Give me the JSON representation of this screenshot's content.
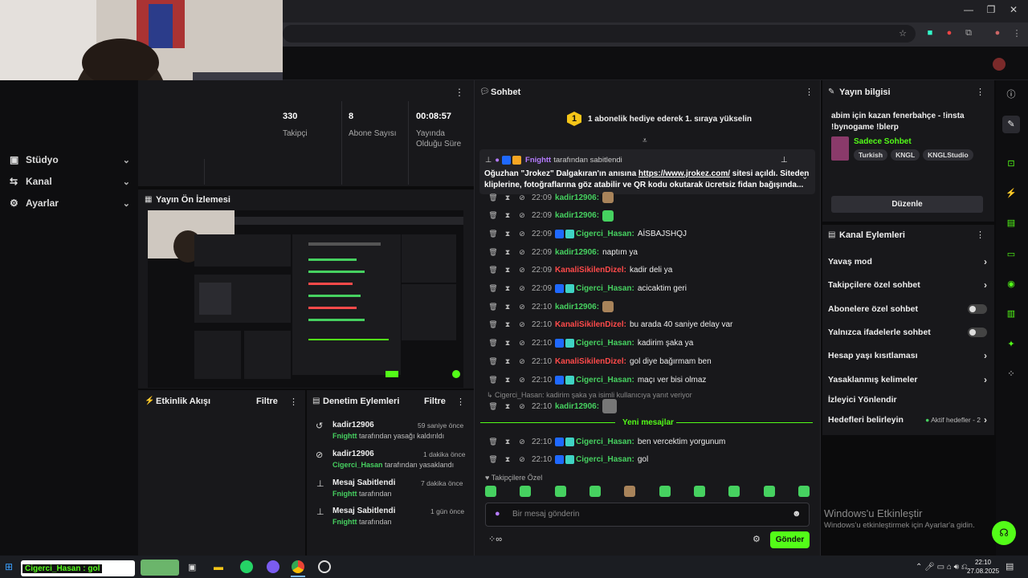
{
  "browser": {
    "minimize": "—",
    "maximize": "❐",
    "close": "✕"
  },
  "sidebar": {
    "items": [
      {
        "label": "Stüdyo",
        "icon": "studio-icon"
      },
      {
        "label": "Kanal",
        "icon": "channel-icon"
      },
      {
        "label": "Ayarlar",
        "icon": "gear-icon"
      }
    ]
  },
  "stats": {
    "followers_value": "330",
    "followers_label": "Takipçi",
    "subs_value": "8",
    "subs_label": "Abone Sayısı",
    "uptime_value": "00:08:57",
    "uptime_label_1": "Yayında",
    "uptime_label_2": "Olduğu Süre"
  },
  "preview": {
    "title": "Yayın Ön İzlemesi"
  },
  "activity": {
    "title": "Etkinlik Akışı",
    "filter": "Filtre"
  },
  "moderation": {
    "title": "Denetim Eylemleri",
    "filter": "Filtre",
    "events": [
      {
        "name": "kadir12906",
        "time": "59 saniye önce",
        "actor": "Fnightt",
        "text": "tarafından yasağı kaldırıldı"
      },
      {
        "name": "kadir12906",
        "time": "1 dakika önce",
        "actor": "Cigerci_Hasan",
        "text": "tarafından yasaklandı"
      },
      {
        "name": "Mesaj Sabitlendi",
        "time": "7 dakika önce",
        "actor": "Fnightt",
        "text": "tarafından"
      },
      {
        "name": "Mesaj Sabitlendi",
        "time": "1 gün önce",
        "actor": "Fnightt",
        "text": "tarafından"
      }
    ]
  },
  "chat": {
    "title": "Sohbet",
    "hype_number": "1",
    "hype_text": "1 abonelik hediye ederek 1. sıraya yükselin",
    "pinned_by": "Fnightt",
    "pinned_suffix": "tarafından sabitlendi",
    "pinned_text_1": "Oğuzhan \"Jrokez\" Dalgakıran'ın anısına ",
    "pinned_link": "https://www.jrokez.com/",
    "pinned_text_2": " sitesi açıldı. Siteden",
    "pinned_text_3": "kliplerine, fotoğraflarına göz atabilir ve QR kodu okutarak ücretsiz fidan bağışında...",
    "messages": [
      {
        "time": "22:09",
        "user": "kadir12906:",
        "text": "",
        "color": "#46d160",
        "badges": 0,
        "emote": "b"
      },
      {
        "time": "22:09",
        "user": "kadir12906:",
        "text": "",
        "color": "#46d160",
        "badges": 0,
        "emote": "g"
      },
      {
        "time": "22:09",
        "user": "Cigerci_Hasan:",
        "text": "AİSBAJSHQJ",
        "color": "#46d160",
        "badges": 2,
        "emote": ""
      },
      {
        "time": "22:09",
        "user": "kadir12906:",
        "text": "naptım ya",
        "color": "#46d160",
        "badges": 0,
        "emote": ""
      },
      {
        "time": "22:09",
        "user": "KanaliSikilenDizel:",
        "text": "kadir deli ya",
        "color": "#ff4a4a",
        "badges": 0,
        "emote": ""
      },
      {
        "time": "22:09",
        "user": "Cigerci_Hasan:",
        "text": "acicaktim geri",
        "color": "#46d160",
        "badges": 2,
        "emote": ""
      },
      {
        "time": "22:10",
        "user": "kadir12906:",
        "text": "",
        "color": "#46d160",
        "badges": 0,
        "emote": "b"
      },
      {
        "time": "22:10",
        "user": "KanaliSikilenDizel:",
        "text": "bu arada 40 saniye delay var",
        "color": "#ff4a4a",
        "badges": 0,
        "emote": ""
      },
      {
        "time": "22:10",
        "user": "Cigerci_Hasan:",
        "text": "kadirim şaka ya",
        "color": "#46d160",
        "badges": 2,
        "emote": ""
      },
      {
        "time": "22:10",
        "user": "KanaliSikilenDizel:",
        "text": "gol diye bağırmam ben",
        "color": "#ff4a4a",
        "badges": 0,
        "emote": ""
      },
      {
        "time": "22:10",
        "user": "Cigerci_Hasan:",
        "text": "maçı ver bisi olmaz",
        "color": "#46d160",
        "badges": 2,
        "emote": ""
      }
    ],
    "reply_hint": "Cigerci_Hasan: kadirim şaka ya isimli kullanıcıya yanıt veriyor",
    "reply_msg": {
      "time": "22:10",
      "user": "kadir12906:"
    },
    "new_messages": "Yeni mesajlar",
    "after": [
      {
        "time": "22:10",
        "user": "Cigerci_Hasan:",
        "text": "ben vercektim yorgunum"
      },
      {
        "time": "22:10",
        "user": "Cigerci_Hasan:",
        "text": "gol"
      }
    ],
    "followers_only": "Takipçilere Özel",
    "input_placeholder": "Bir mesaj gönderin",
    "send": "Gönder"
  },
  "info": {
    "title": "Yayın bilgisi",
    "stream_title": "abim için kazan fenerbahçe - !insta !bynogame !blerp",
    "category": "Sadece Sohbet",
    "tags": [
      "Turkish",
      "KNGL",
      "KNGLStudio"
    ],
    "edit": "Düzenle"
  },
  "channel_actions": {
    "title": "Kanal Eylemleri",
    "items": [
      {
        "label": "Yavaş mod",
        "kind": "chevron"
      },
      {
        "label": "Takipçilere özel sohbet",
        "kind": "chevron"
      },
      {
        "label": "Abonelere özel sohbet",
        "kind": "toggle"
      },
      {
        "label": "Yalnızca ifadelerle sohbet",
        "kind": "toggle"
      },
      {
        "label": "Hesap yaşı kısıtlaması",
        "kind": "chevron"
      },
      {
        "label": "Yasaklanmış kelimeler",
        "kind": "chevron"
      },
      {
        "label": "İzleyici Yönlendir",
        "kind": "none"
      },
      {
        "label": "Hedefleri belirleyin",
        "kind": "goal"
      }
    ],
    "goal_status": "Aktif hedefler - 2"
  },
  "windows": {
    "activate_title": "Windows'u Etkinleştir",
    "activate_sub": "Windows'u etkinleştirmek için Ayarlar'a gidin."
  },
  "taskbar": {
    "notification": "Cigerci_Hasan : gol",
    "time": "22:10",
    "date": "27.08.2025"
  },
  "colors": {
    "accent": "#53fc18",
    "name_green": "#46d160",
    "name_red": "#ff4a4a",
    "panel": "#18181b"
  }
}
